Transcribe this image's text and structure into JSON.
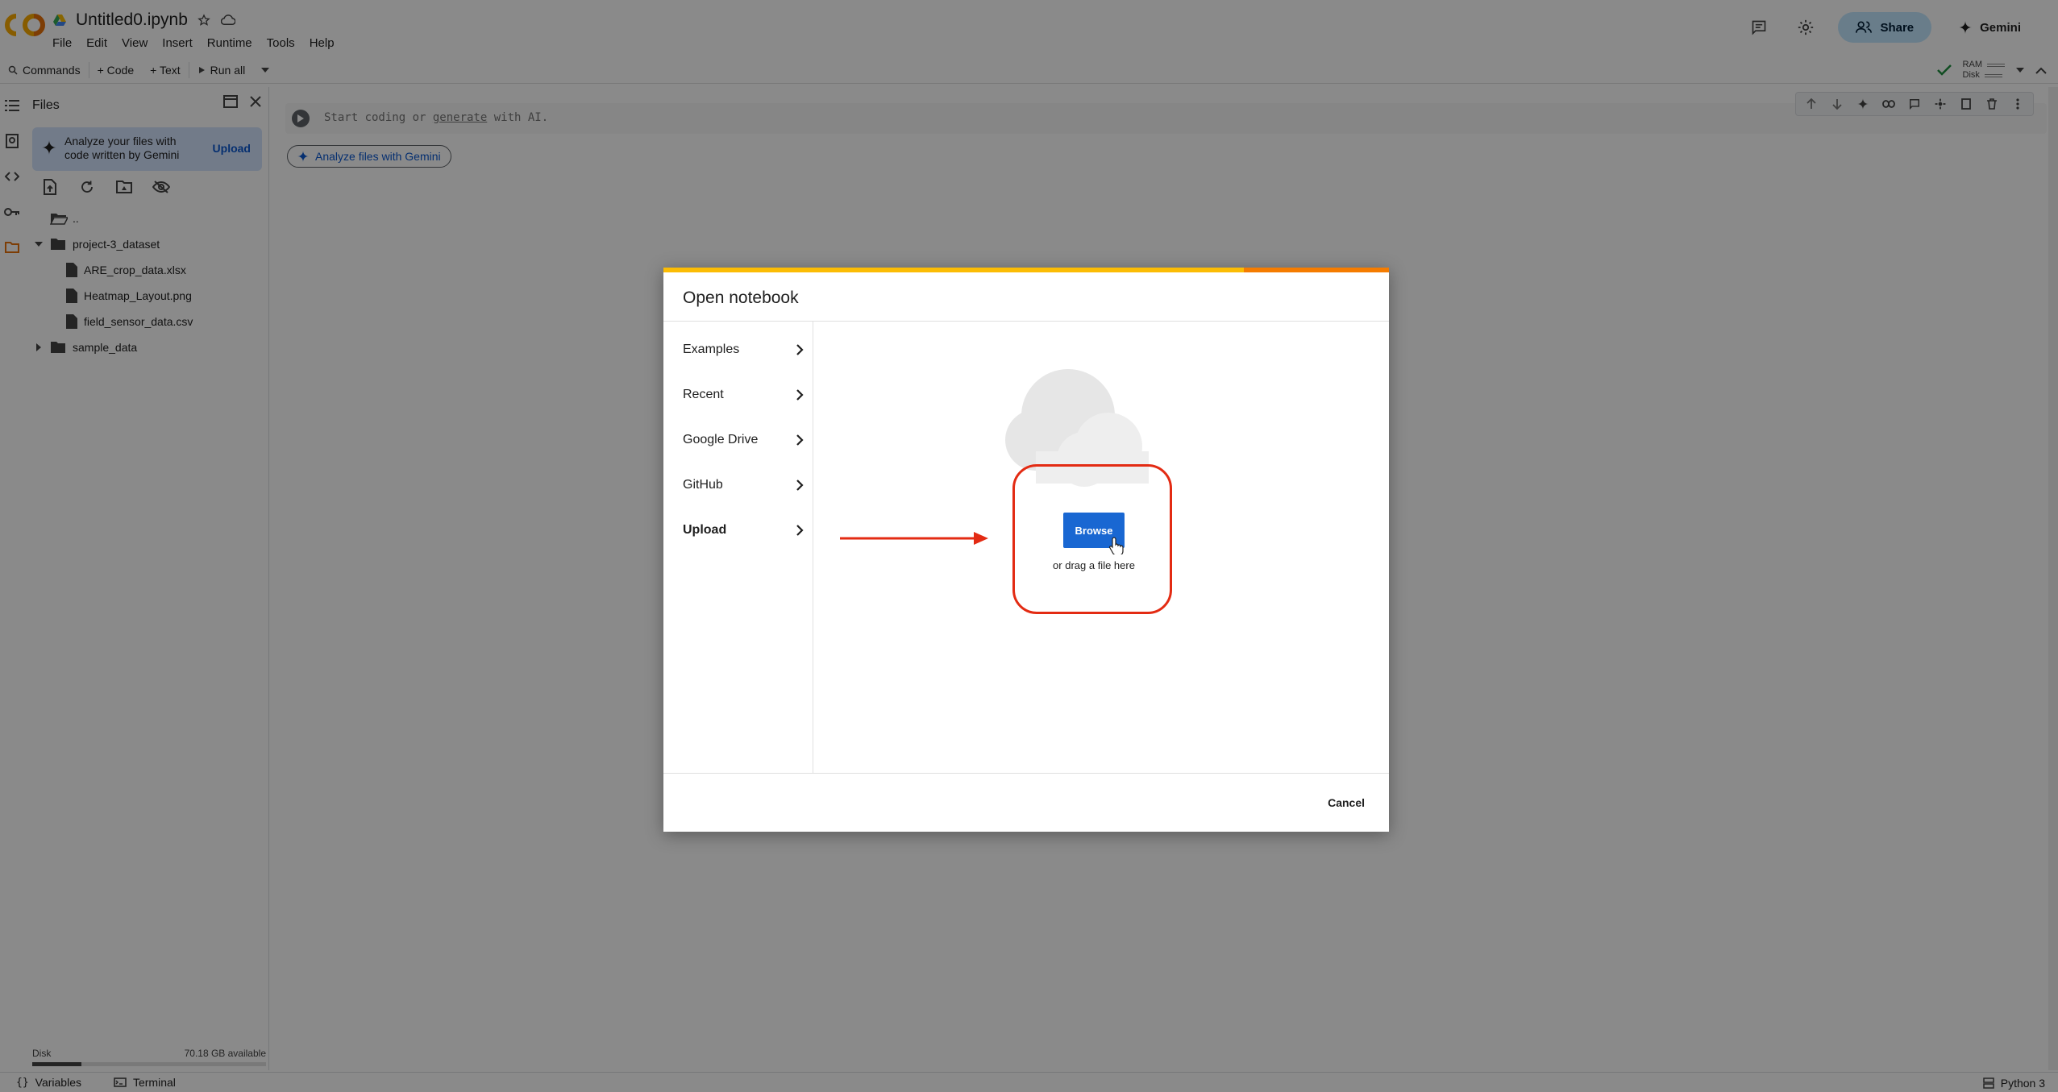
{
  "app": {
    "notebook_title": "Untitled0.ipynb",
    "menu": [
      "File",
      "Edit",
      "View",
      "Insert",
      "Runtime",
      "Tools",
      "Help"
    ],
    "share_label": "Share",
    "gemini_label": "Gemini"
  },
  "toolbar": {
    "commands_label": "Commands",
    "code_label": "+ Code",
    "text_label": "+ Text",
    "run_all_label": "Run all",
    "ram_label": "RAM",
    "disk_label": "Disk"
  },
  "files_panel": {
    "title": "Files",
    "banner_text": "Analyze your files with code written by Gemini",
    "banner_upload": "Upload",
    "tree": [
      {
        "label": "..",
        "type": "parent-folder"
      },
      {
        "label": "project-3_dataset",
        "type": "folder",
        "expanded": true
      },
      {
        "label": "ARE_crop_data.xlsx",
        "type": "file"
      },
      {
        "label": "Heatmap_Layout.png",
        "type": "file"
      },
      {
        "label": "field_sensor_data.csv",
        "type": "file"
      },
      {
        "label": "sample_data",
        "type": "folder",
        "expanded": false
      }
    ],
    "disk_label": "Disk",
    "disk_available": "70.18 GB available",
    "disk_used_fraction": 0.21
  },
  "notebook": {
    "cell_placeholder_pre": "Start coding or ",
    "cell_placeholder_link": "generate",
    "cell_placeholder_post": " with AI.",
    "analyze_chip": "Analyze files with Gemini"
  },
  "statusbar": {
    "variables_label": "Variables",
    "terminal_label": "Terminal",
    "runtime_label": "Python 3"
  },
  "dialog": {
    "title": "Open notebook",
    "progress_fraction": 0.8,
    "nav": [
      {
        "label": "Examples",
        "active": false
      },
      {
        "label": "Recent",
        "active": false
      },
      {
        "label": "Google Drive",
        "active": false
      },
      {
        "label": "GitHub",
        "active": false
      },
      {
        "label": "Upload",
        "active": true
      }
    ],
    "browse_label": "Browse",
    "drag_text": "or drag a file here",
    "cancel_label": "Cancel"
  },
  "colors": {
    "accent": "#1967d2",
    "annotation": "#e32b13",
    "progress_bar": "#f57c00",
    "progress_fill": "#fbbc04",
    "share_bg": "#c2e7ff"
  }
}
